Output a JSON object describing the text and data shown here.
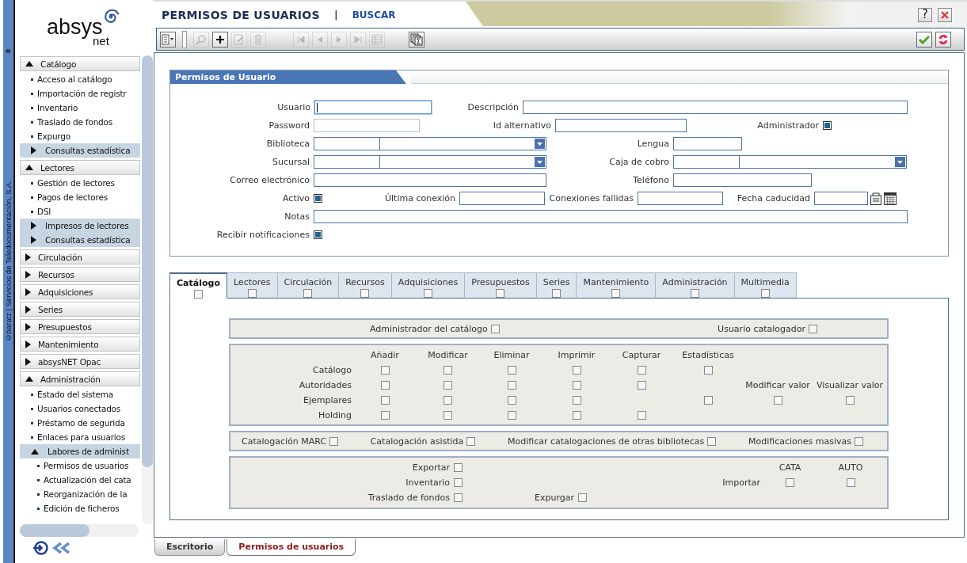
{
  "side_strip": {
    "collapse_glyph": "«",
    "credit": "©baratz | Servicios de Teledocumentación, S.A."
  },
  "logo": {
    "name": "absys",
    "suffix": "net"
  },
  "sidebar": {
    "sections": [
      {
        "label": "Catálogo",
        "expanded": true,
        "items": [
          {
            "kind": "link",
            "label": "Acceso al catálogo"
          },
          {
            "kind": "link",
            "label": "Importación de registr"
          },
          {
            "kind": "link",
            "label": "Inventario"
          },
          {
            "kind": "link",
            "label": "Traslado de fondos"
          },
          {
            "kind": "link",
            "label": "Expurgo"
          },
          {
            "kind": "group",
            "label": "Consultas estadística",
            "expanded": false
          }
        ]
      },
      {
        "label": "Lectores",
        "expanded": true,
        "items": [
          {
            "kind": "link",
            "label": "Gestión de lectores"
          },
          {
            "kind": "link",
            "label": "Pagos de lectores"
          },
          {
            "kind": "link",
            "label": "DSI"
          },
          {
            "kind": "group",
            "label": "Impresos de lectores",
            "expanded": false
          },
          {
            "kind": "group",
            "label": "Consultas estadística",
            "expanded": false
          }
        ]
      },
      {
        "label": "Circulación",
        "expanded": false
      },
      {
        "label": "Recursos",
        "expanded": false
      },
      {
        "label": "Adquisiciones",
        "expanded": false
      },
      {
        "label": "Series",
        "expanded": false
      },
      {
        "label": "Presupuestos",
        "expanded": false
      },
      {
        "label": "Mantenimiento",
        "expanded": false
      },
      {
        "label": "absysNET Opac",
        "expanded": false
      },
      {
        "label": "Administración",
        "expanded": true,
        "items": [
          {
            "kind": "link",
            "label": "Estado del sistema"
          },
          {
            "kind": "link",
            "label": "Usuarios conectados"
          },
          {
            "kind": "link",
            "label": "Préstamo de segurida"
          },
          {
            "kind": "link",
            "label": "Enlaces para usuarios"
          },
          {
            "kind": "group",
            "label": "Labores de administ",
            "expanded": true,
            "children": [
              {
                "label": "Permisos de usuarios"
              },
              {
                "label": "Actualización del cata"
              },
              {
                "label": "Reorganización de la"
              },
              {
                "label": "Edición de ficheros"
              }
            ]
          }
        ]
      }
    ]
  },
  "header": {
    "title": "PERMISOS DE USUARIOS",
    "separator": "|",
    "link": "BUSCAR",
    "help": "?"
  },
  "toolbar": {
    "left": [
      {
        "kind": "menu",
        "disabled": false
      },
      {
        "kind": "search",
        "disabled": true
      },
      {
        "kind": "add",
        "disabled": false
      },
      {
        "kind": "edit",
        "disabled": true
      },
      {
        "kind": "delete",
        "disabled": true
      },
      {
        "kind": "first",
        "disabled": true
      },
      {
        "kind": "prev",
        "disabled": true
      },
      {
        "kind": "next",
        "disabled": true
      },
      {
        "kind": "last",
        "disabled": true
      },
      {
        "kind": "grid",
        "disabled": true
      },
      {
        "kind": "stats",
        "disabled": false
      }
    ],
    "right": [
      {
        "kind": "confirm",
        "disabled": false
      },
      {
        "kind": "refresh",
        "disabled": false
      }
    ]
  },
  "form": {
    "title": "Permisos de Usuario",
    "rows": [
      [
        {
          "label": "Usuario",
          "kind": "text",
          "focused": true
        },
        {
          "label": "Descripción",
          "kind": "text",
          "focused": false
        }
      ],
      [
        {
          "label": "Password",
          "kind": "password",
          "focused": false
        },
        {
          "label": "Id alternativo",
          "kind": "text",
          "focused": false
        },
        {
          "kind": "blank"
        },
        {
          "label": "Administrador",
          "kind": "check",
          "checked": true
        }
      ],
      [
        {
          "label": "Biblioteca",
          "kind": "combo"
        },
        {
          "label": "Lengua",
          "kind": "text",
          "focused": false
        }
      ],
      [
        {
          "label": "Sucursal",
          "kind": "combo"
        },
        {
          "label": "Caja de cobro",
          "kind": "combo"
        }
      ],
      [
        {
          "label": "Correo electrónico",
          "kind": "text",
          "focused": false
        },
        {
          "label": "Teléfono",
          "kind": "text",
          "focused": false
        }
      ],
      [
        {
          "label": "Activo",
          "kind": "check",
          "checked": true
        },
        {
          "label": "Última conexión",
          "kind": "text",
          "focused": false
        },
        {
          "label": "Conexiones fallidas",
          "kind": "text",
          "focused": false
        },
        {
          "label": "Fecha caducidad",
          "kind": "date",
          "focused": false
        }
      ],
      [
        {
          "label": "Notas",
          "kind": "text",
          "focused": false
        }
      ],
      [
        {
          "label": "Recibir notificaciones",
          "kind": "check",
          "checked": true
        }
      ]
    ]
  },
  "tabs": [
    {
      "label": "Catálogo",
      "selected": true,
      "checked": false
    },
    {
      "label": "Lectores",
      "selected": false,
      "checked": false
    },
    {
      "label": "Circulación",
      "selected": false,
      "checked": false
    },
    {
      "label": "Recursos",
      "selected": false,
      "checked": false
    },
    {
      "label": "Adquisiciones",
      "selected": false,
      "checked": false
    },
    {
      "label": "Presupuestos",
      "selected": false,
      "checked": false
    },
    {
      "label": "Series",
      "selected": false,
      "checked": false
    },
    {
      "label": "Mantenimiento",
      "selected": false,
      "checked": false
    },
    {
      "label": "Administración",
      "selected": false,
      "checked": false
    },
    {
      "label": "Multimedia",
      "selected": false,
      "checked": false
    }
  ],
  "catalog": {
    "roles": [
      {
        "label": "Administrador del catálogo",
        "checked": false
      },
      {
        "label": "Usuario catalogador",
        "checked": false
      }
    ],
    "matrix": {
      "headers": [
        "Añadir",
        "Modificar",
        "Eliminar",
        "Imprimir",
        "Capturar",
        "Estadísticas"
      ],
      "rows": [
        {
          "label": "Catálogo",
          "cells": [
            {
              "kind": "check",
              "checked": false
            },
            {
              "kind": "check",
              "checked": false
            },
            {
              "kind": "check",
              "checked": false
            },
            {
              "kind": "check",
              "checked": false
            },
            {
              "kind": "check",
              "checked": false
            },
            {
              "kind": "check",
              "checked": false
            }
          ]
        },
        {
          "label": "Autoridades",
          "cells": [
            {
              "kind": "check",
              "checked": false
            },
            {
              "kind": "check",
              "checked": false
            },
            {
              "kind": "check",
              "checked": false
            },
            {
              "kind": "check",
              "checked": false
            },
            {
              "kind": "check",
              "checked": false
            },
            {
              "kind": "empty"
            },
            {
              "kind": "heading",
              "label": "Modificar valor"
            },
            {
              "kind": "heading",
              "label": "Visualizar valor"
            }
          ]
        },
        {
          "label": "Ejemplares",
          "cells": [
            {
              "kind": "check",
              "checked": false
            },
            {
              "kind": "check",
              "checked": false
            },
            {
              "kind": "check",
              "checked": false
            },
            {
              "kind": "check",
              "checked": false
            },
            {
              "kind": "empty"
            },
            {
              "kind": "check",
              "checked": false
            },
            {
              "kind": "check",
              "checked": false
            },
            {
              "kind": "check",
              "checked": false
            }
          ]
        },
        {
          "label": "Holding",
          "cells": [
            {
              "kind": "check",
              "checked": false
            },
            {
              "kind": "check",
              "checked": false
            },
            {
              "kind": "check",
              "checked": false
            },
            {
              "kind": "check",
              "checked": false
            },
            {
              "kind": "check",
              "checked": false
            }
          ]
        }
      ]
    },
    "options": [
      {
        "label": "Catalogación MARC",
        "checked": false
      },
      {
        "label": "Catalogación asistida",
        "checked": false
      },
      {
        "label": "Modificar catalogaciones de otras bibliotecas",
        "checked": false
      },
      {
        "label": "Modificaciones masivas",
        "checked": false
      }
    ],
    "tools": {
      "left": [
        {
          "label": "Exportar",
          "checked": false
        },
        {
          "label": "Inventario",
          "checked": false
        },
        {
          "label": "Traslado de fondos",
          "checked": false
        }
      ],
      "expurgar": {
        "label": "Expurgar",
        "checked": false
      },
      "import": {
        "label": "Importar",
        "columns": [
          {
            "label": "CATA",
            "checked": false
          },
          {
            "label": "AUTO",
            "checked": false
          }
        ]
      }
    }
  },
  "bottom_tabs": [
    {
      "label": "Escritorio",
      "selected": false
    },
    {
      "label": "Permisos de usuarios",
      "selected": true
    }
  ]
}
